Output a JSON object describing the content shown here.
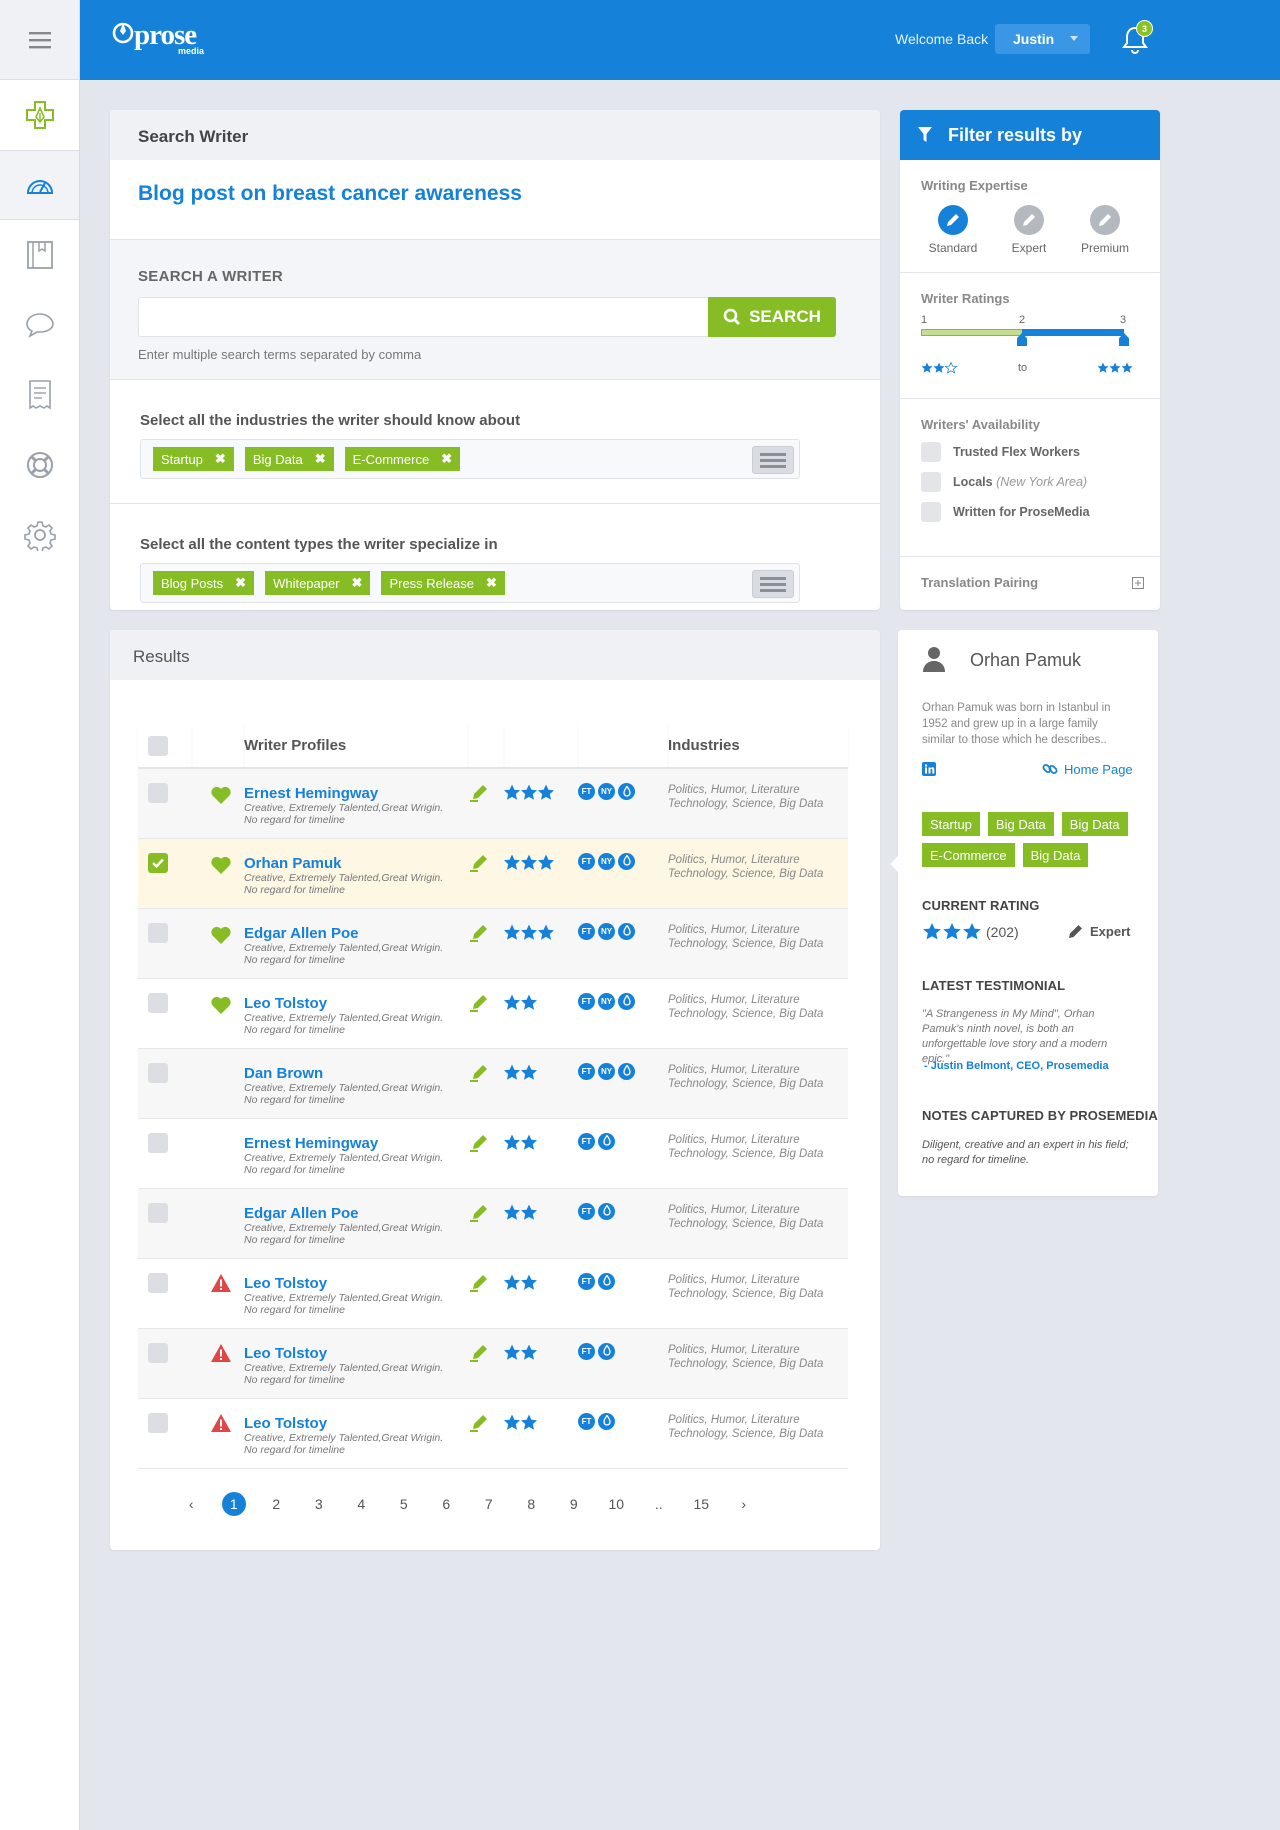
{
  "app": {
    "brand": "prose",
    "brand_sub": "media"
  },
  "header": {
    "welcome": "Welcome Back",
    "user": "Justin",
    "notifications": "3"
  },
  "sidebar": {
    "items": [
      "menu-icon",
      "add-project-icon",
      "dashboard-icon",
      "library-icon",
      "chat-icon",
      "invoice-icon",
      "support-icon",
      "settings-icon"
    ]
  },
  "search_card": {
    "title": "Search Writer",
    "project": "Blog post on breast cancer awareness",
    "search_label": "SEARCH A WRITER",
    "search_value": "",
    "search_placeholder": "",
    "search_button": "SEARCH",
    "hint": "Enter multiple search terms separated by comma",
    "industries_label": "Select all the industries the writer should know about",
    "industries": [
      "Startup",
      "Big Data",
      "E-Commerce"
    ],
    "content_label": "Select all the content types the writer specialize in",
    "content_types": [
      "Blog Posts",
      "Whitepaper",
      "Press Release"
    ]
  },
  "results": {
    "title": "Results",
    "col_profiles": "Writer Profiles",
    "col_industries": "Industries",
    "rows": [
      {
        "name": "Ernest Hemingway",
        "desc1": "Creative, Extremely Talented,Great Wrigin.",
        "desc2": "No regard for timeline",
        "ind1": "Politics, Humor, Literature",
        "ind2": "Technology, Science, Big Data",
        "status": "heart",
        "stars": 3,
        "badges": [
          "FT",
          "NY",
          "W"
        ],
        "checked": false
      },
      {
        "name": "Orhan Pamuk",
        "desc1": "Creative, Extremely Talented,Great Wrigin.",
        "desc2": "No regard for timeline",
        "ind1": "Politics, Humor, Literature",
        "ind2": "Technology, Science, Big Data",
        "status": "heart",
        "stars": 3,
        "badges": [
          "FT",
          "NY",
          "W"
        ],
        "checked": true
      },
      {
        "name": "Edgar Allen Poe",
        "desc1": "Creative, Extremely Talented,Great Wrigin.",
        "desc2": "No regard for timeline",
        "ind1": "Politics, Humor, Literature",
        "ind2": "Technology, Science, Big Data",
        "status": "heart",
        "stars": 3,
        "badges": [
          "FT",
          "NY",
          "W"
        ],
        "checked": false
      },
      {
        "name": "Leo Tolstoy",
        "desc1": "Creative, Extremely Talented,Great Wrigin.",
        "desc2": "No regard for timeline",
        "ind1": "Politics, Humor, Literature",
        "ind2": "Technology, Science, Big Data",
        "status": "heart",
        "stars": 2,
        "badges": [
          "FT",
          "NY",
          "W"
        ],
        "checked": false
      },
      {
        "name": "Dan Brown",
        "desc1": "Creative, Extremely Talented,Great Wrigin.",
        "desc2": "No regard for timeline",
        "ind1": "Politics, Humor, Literature",
        "ind2": "Technology, Science, Big Data",
        "status": "none",
        "stars": 2,
        "badges": [
          "FT",
          "NY",
          "W"
        ],
        "checked": false
      },
      {
        "name": "Ernest Hemingway",
        "desc1": "Creative, Extremely Talented,Great Wrigin.",
        "desc2": "No regard for timeline",
        "ind1": "Politics, Humor, Literature",
        "ind2": "Technology, Science, Big Data",
        "status": "none",
        "stars": 2,
        "badges": [
          "FT",
          "W"
        ],
        "checked": false
      },
      {
        "name": "Edgar Allen Poe",
        "desc1": "Creative, Extremely Talented,Great Wrigin.",
        "desc2": "No regard for timeline",
        "ind1": "Politics, Humor, Literature",
        "ind2": "Technology, Science, Big Data",
        "status": "none",
        "stars": 2,
        "badges": [
          "FT",
          "W"
        ],
        "checked": false
      },
      {
        "name": "Leo Tolstoy",
        "desc1": "Creative, Extremely Talented,Great Wrigin.",
        "desc2": "No regard for timeline",
        "ind1": "Politics, Humor, Literature",
        "ind2": "Technology, Science, Big Data",
        "status": "warning",
        "stars": 2,
        "badges": [
          "FT",
          "W"
        ],
        "checked": false
      },
      {
        "name": "Leo Tolstoy",
        "desc1": "Creative, Extremely Talented,Great Wrigin.",
        "desc2": "No regard for timeline",
        "ind1": "Politics, Humor, Literature",
        "ind2": "Technology, Science, Big Data",
        "status": "warning",
        "stars": 2,
        "badges": [
          "FT",
          "W"
        ],
        "checked": false
      },
      {
        "name": "Leo Tolstoy",
        "desc1": "Creative, Extremely Talented,Great Wrigin.",
        "desc2": "No regard for timeline",
        "ind1": "Politics, Humor, Literature",
        "ind2": "Technology, Science, Big Data",
        "status": "warning",
        "stars": 2,
        "badges": [
          "FT",
          "W"
        ],
        "checked": false
      }
    ],
    "pagination": [
      "‹",
      "1",
      "2",
      "3",
      "4",
      "5",
      "6",
      "7",
      "8",
      "9",
      "10",
      "..",
      "15",
      "›"
    ],
    "current_page": "1"
  },
  "filter": {
    "title": "Filter results by",
    "expertise_label": "Writing Expertise",
    "expertise": [
      {
        "label": "Standard",
        "active": true
      },
      {
        "label": "Expert",
        "active": false
      },
      {
        "label": "Premium",
        "active": false
      }
    ],
    "ratings_label": "Writer Ratings",
    "rating_ticks": [
      "1",
      "2",
      "3"
    ],
    "rating_from": 2,
    "rating_to": 3,
    "rating_to_word": "to",
    "availability_label": "Writers' Availability",
    "availability": [
      {
        "label": "Trusted Flex Workers",
        "note": ""
      },
      {
        "label": "Locals",
        "note": "(New York Area)"
      },
      {
        "label": "Written for ProseMedia",
        "note": ""
      }
    ],
    "translation_label": "Translation Pairing",
    "accent": "#1681d9",
    "green": "#86bd25"
  },
  "profile": {
    "name": "Orhan Pamuk",
    "bio": "Orhan Pamuk was born in Istanbul in 1952 and grew up in a large family similar to those which he describes..",
    "homepage": "Home Page",
    "tags": [
      "Startup",
      "Big Data",
      "Big Data",
      "E-Commerce",
      "Big Data"
    ],
    "rating_label": "CURRENT RATING",
    "rating_count": "(202)",
    "level": "Expert",
    "testimonial_label": "LATEST TESTIMONIAL",
    "testimonial": "\"A Strangeness in My Mind\", Orhan Pamuk's ninth novel, is both an unforgettable love story and a modern epic.\"",
    "testimonial_author": "- Justin Belmont, CEO, Prosemedia",
    "notes_label": "NOTES CAPTURED BY PROSEMEDIA",
    "notes": "Diligent, creative and an expert in his field; no regard for timeline."
  }
}
